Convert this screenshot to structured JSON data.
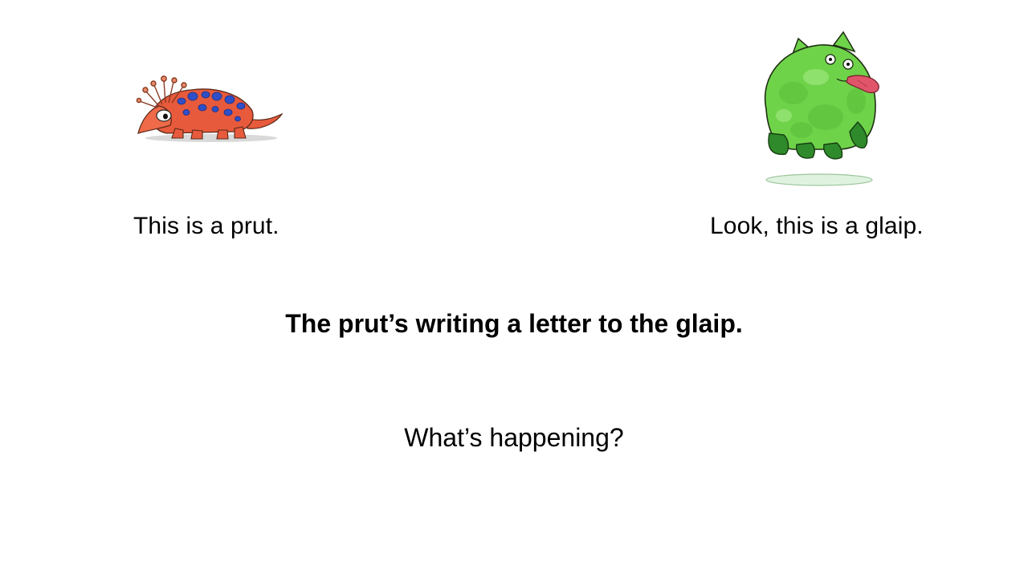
{
  "slide": {
    "left_caption": "This is a prut.",
    "right_caption": "Look, this is a glaip.",
    "main_sentence": "The prut’s writing a letter to the glaip.",
    "question": "What’s happening?"
  },
  "illustrations": {
    "prut": {
      "icon": "prut-creature-illustration",
      "body_color": "#e85a3c",
      "spot_color": "#2f4fc8"
    },
    "glaip": {
      "icon": "glaip-creature-illustration",
      "body_color": "#6fd34a",
      "tongue_color": "#e0556a"
    }
  }
}
